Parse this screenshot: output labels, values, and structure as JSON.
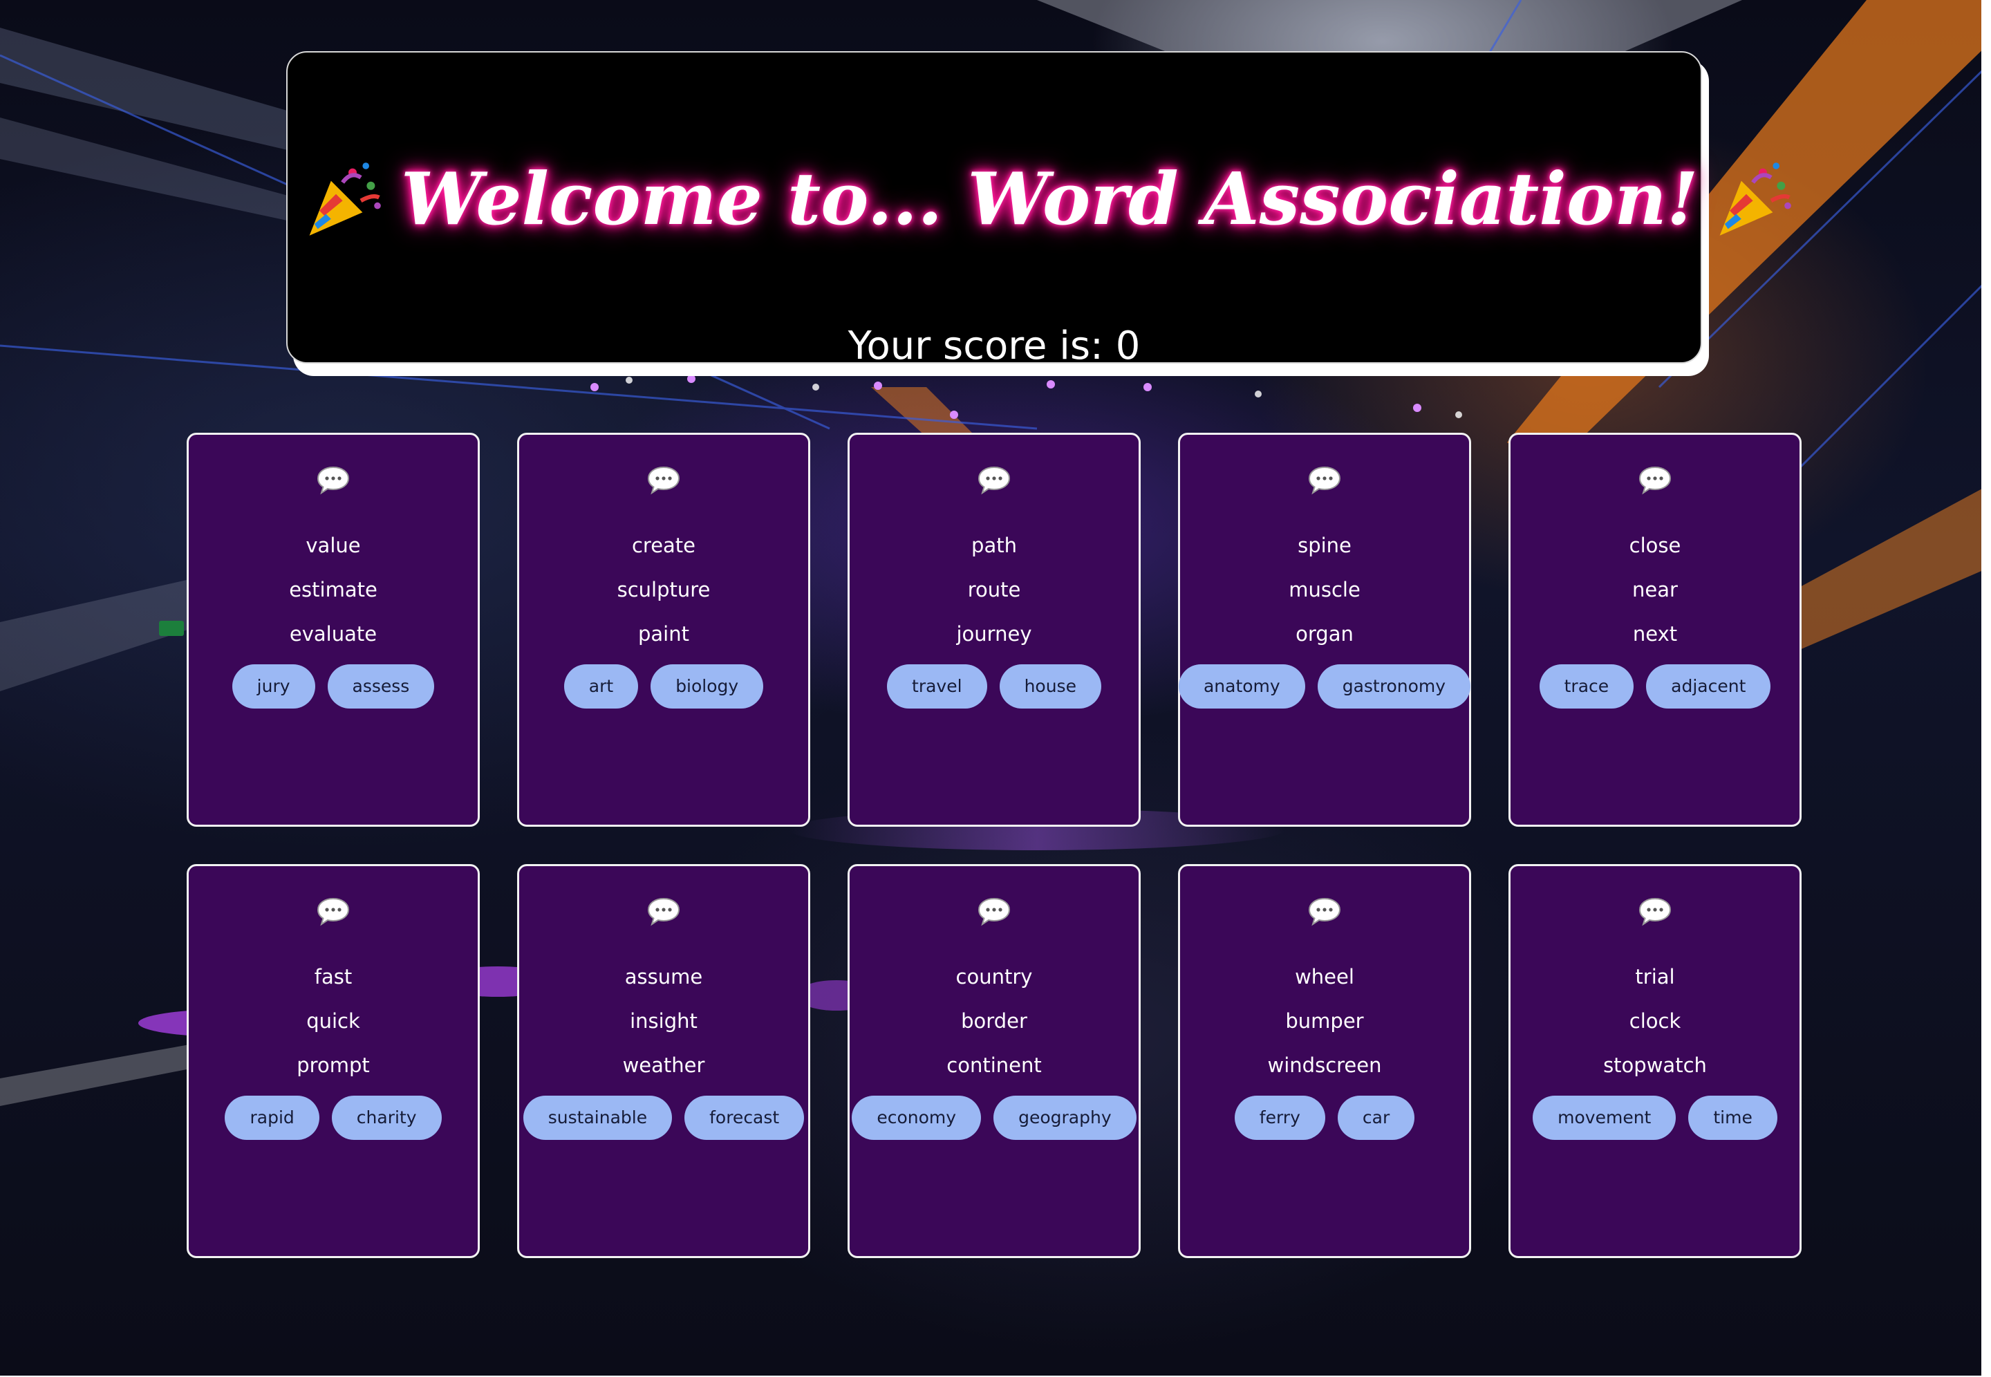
{
  "header": {
    "title": "Welcome to... Word Association!",
    "score_text": "Your score is: 0"
  },
  "icons": {
    "title_left": "party-popper-icon",
    "title_right": "party-popper-icon",
    "card_icon": "speech-bubble-icon"
  },
  "colors": {
    "card_bg": "#3b0758",
    "option_bg": "#9bb8f4",
    "title_glow": "#ff1493",
    "header_bg": "#000000"
  },
  "cards": [
    {
      "words": [
        "value",
        "estimate",
        "evaluate"
      ],
      "options": [
        "jury",
        "assess"
      ]
    },
    {
      "words": [
        "create",
        "sculpture",
        "paint"
      ],
      "options": [
        "art",
        "biology"
      ]
    },
    {
      "words": [
        "path",
        "route",
        "journey"
      ],
      "options": [
        "travel",
        "house"
      ]
    },
    {
      "words": [
        "spine",
        "muscle",
        "organ"
      ],
      "options": [
        "anatomy",
        "gastronomy"
      ]
    },
    {
      "words": [
        "close",
        "near",
        "next"
      ],
      "options": [
        "trace",
        "adjacent"
      ]
    },
    {
      "words": [
        "fast",
        "quick",
        "prompt"
      ],
      "options": [
        "rapid",
        "charity"
      ]
    },
    {
      "words": [
        "assume",
        "insight",
        "weather"
      ],
      "options": [
        "sustainable",
        "forecast"
      ]
    },
    {
      "words": [
        "country",
        "border",
        "continent"
      ],
      "options": [
        "economy",
        "geography"
      ]
    },
    {
      "words": [
        "wheel",
        "bumper",
        "windscreen"
      ],
      "options": [
        "ferry",
        "car"
      ]
    },
    {
      "words": [
        "trial",
        "clock",
        "stopwatch"
      ],
      "options": [
        "movement",
        "time"
      ]
    }
  ]
}
